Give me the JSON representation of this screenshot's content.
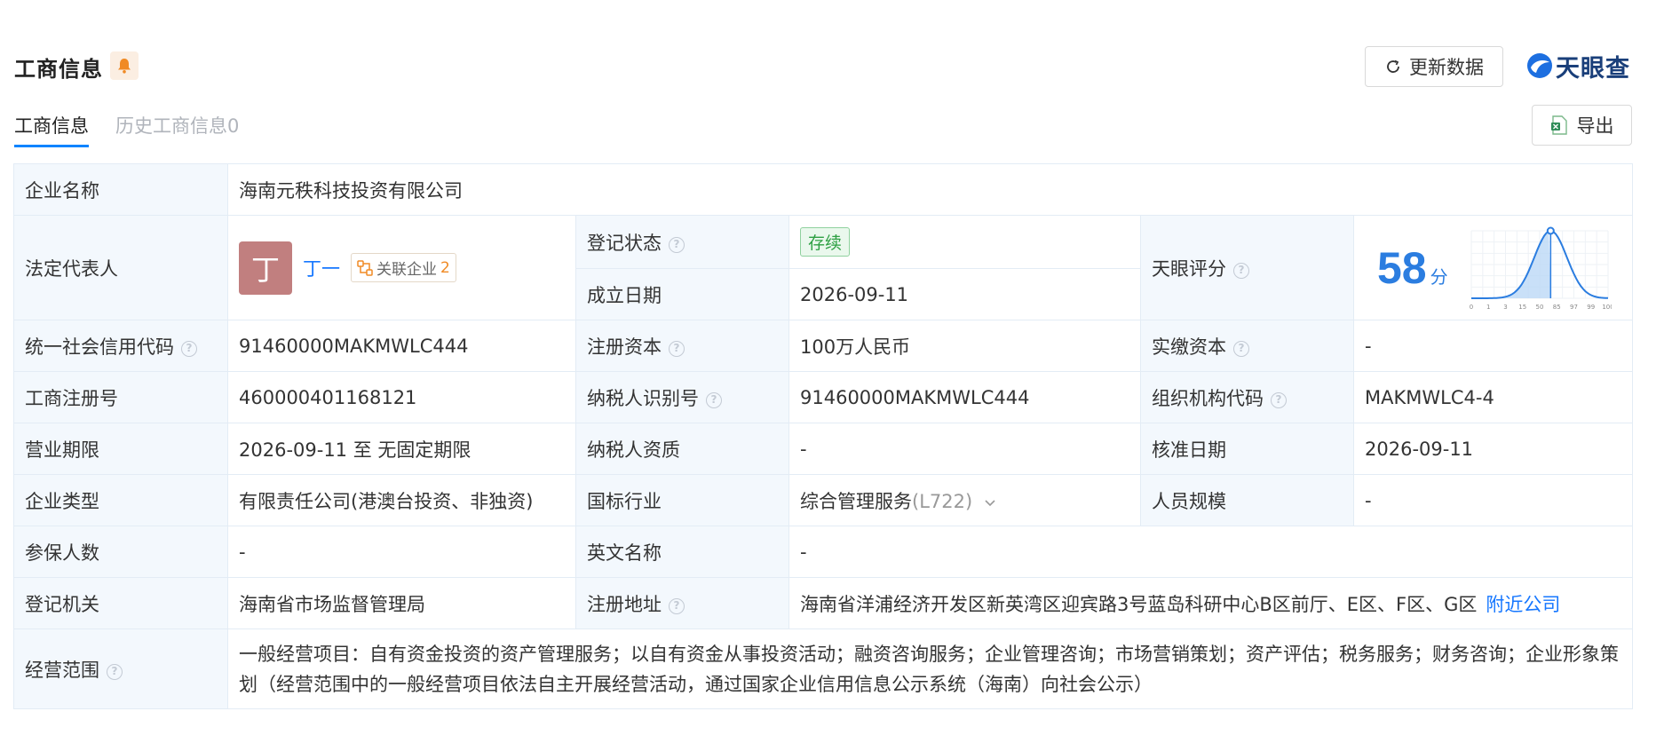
{
  "header": {
    "title": "工商信息",
    "update_button": "更新数据",
    "logo_text": "天眼查"
  },
  "tabs": [
    {
      "label": "工商信息"
    },
    {
      "label": "历史工商信息0"
    }
  ],
  "export_button": "导出",
  "rows": {
    "company_name": {
      "label": "企业名称",
      "value": "海南元秩科技投资有限公司"
    },
    "legal_rep": {
      "label": "法定代表人",
      "avatar": "丁",
      "name": "丁一",
      "related_label": "关联企业",
      "related_count": "2"
    },
    "reg_status": {
      "label": "登记状态",
      "value": "存续"
    },
    "found_date": {
      "label": "成立日期",
      "value": "2026-09-11"
    },
    "tianyan_score": {
      "label": "天眼评分",
      "score": "58",
      "unit": "分",
      "percentile": 0.58,
      "axis_ticks": [
        "0",
        "1",
        "3",
        "15",
        "50",
        "85",
        "97",
        "99",
        "100"
      ]
    },
    "credit_code": {
      "label": "统一社会信用代码",
      "value": "91460000MAKMWLC444"
    },
    "reg_capital": {
      "label": "注册资本",
      "value": "100万人民币"
    },
    "paid_capital": {
      "label": "实缴资本",
      "value": "-"
    },
    "reg_no": {
      "label": "工商注册号",
      "value": "460000401168121"
    },
    "taxpayer_id": {
      "label": "纳税人识别号",
      "value": "91460000MAKMWLC444"
    },
    "org_code": {
      "label": "组织机构代码",
      "value": "MAKMWLC4-4"
    },
    "biz_term": {
      "label": "营业期限",
      "value": "2026-09-11 至 无固定期限"
    },
    "taxpayer_qual": {
      "label": "纳税人资质",
      "value": "-"
    },
    "approve_date": {
      "label": "核准日期",
      "value": "2026-09-11"
    },
    "company_type": {
      "label": "企业类型",
      "value": "有限责任公司(港澳台投资、非独资)"
    },
    "industry": {
      "label": "国标行业",
      "value": "综合管理服务",
      "code": "(L722)"
    },
    "staff_size": {
      "label": "人员规模",
      "value": "-"
    },
    "insured": {
      "label": "参保人数",
      "value": "-"
    },
    "english_name": {
      "label": "英文名称",
      "value": "-"
    },
    "reg_authority": {
      "label": "登记机关",
      "value": "海南省市场监督管理局"
    },
    "reg_address": {
      "label": "注册地址",
      "value": "海南省洋浦经济开发区新英湾区迎宾路3号蓝岛科研中心B区前厅、E区、F区、G区",
      "nearby": "附近公司"
    },
    "biz_scope": {
      "label": "经营范围",
      "value": "一般经营项目：自有资金投资的资产管理服务；以自有资金从事投资活动；融资咨询服务；企业管理咨询；市场营销策划；资产评估；税务服务；财务咨询；企业形象策划（经营范围中的一般经营项目依法自主开展经营活动，通过国家企业信用信息公示系统（海南）向社会公示）"
    }
  },
  "colors": {
    "accent": "#1677ff",
    "label_bg": "#f3f8fd",
    "status_green": "#2ea043",
    "score_blue": "#2b7de0"
  }
}
